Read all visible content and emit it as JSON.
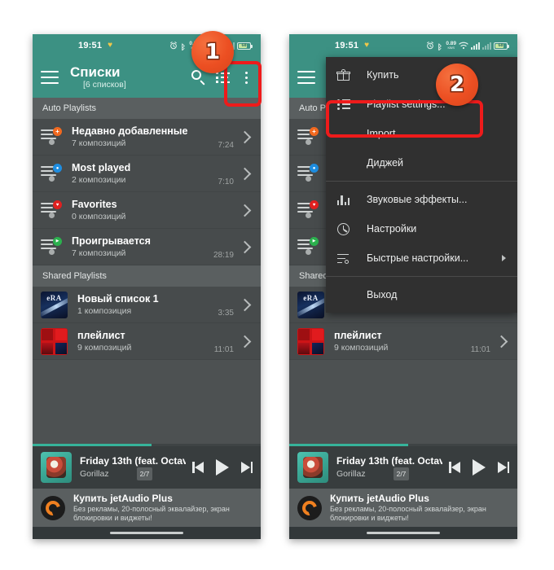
{
  "colors": {
    "teal": "#3c9183",
    "background": "#4d5152",
    "row": "#474b4c",
    "section": "#5a5f60",
    "menu": "#303030",
    "callout": "#ec4f22",
    "highlight": "#ee1b1b",
    "progress": "#36b39a"
  },
  "statusbar": {
    "time": "19:51",
    "heart_icon": "heart-icon",
    "alarm_icon": "alarm-icon",
    "bluetooth_icon": "bluetooth-icon",
    "data_speed_value": "0.15",
    "data_speed_unit": "KB/S",
    "data_speed_value_right": "0.89",
    "wifi_icon": "wifi-icon",
    "signal_icon": "signal-bars-icon",
    "battery_level": "68"
  },
  "toolbar": {
    "menu_icon": "hamburger-menu-icon",
    "title": "Списки",
    "subtitle": "[6 списков]",
    "search_icon": "search-icon",
    "view_icon": "list-view-icon",
    "overflow_icon": "overflow-menu-icon"
  },
  "sections": {
    "auto": "Auto Playlists",
    "shared": "Shared Playlists"
  },
  "auto_playlists": [
    {
      "name": "Недавно добавленные",
      "subtitle": "7 композиций",
      "time": "7:24",
      "badge_color": "#f2691f",
      "badge_glyph": "+",
      "icon": "playlist-icon"
    },
    {
      "name": "Most played",
      "subtitle": "2 композиции",
      "time": "7:10",
      "badge_color": "#1e8de0",
      "badge_glyph": "●",
      "icon": "playlist-icon"
    },
    {
      "name": "Favorites",
      "subtitle": "0 композиций",
      "time": "",
      "badge_color": "#e02020",
      "badge_glyph": "♥",
      "icon": "playlist-icon"
    },
    {
      "name": "Проигрывается",
      "subtitle": "7 композиций",
      "time": "28:19",
      "badge_color": "#2bb14e",
      "badge_glyph": "▶",
      "icon": "playlist-icon"
    }
  ],
  "shared_playlists": [
    {
      "name": "Новый список 1",
      "subtitle": "1 композиция",
      "time": "3:35",
      "art": "era-album-art",
      "art_caption": "eRA"
    },
    {
      "name": "плейлист",
      "subtitle": "9 композиций",
      "time": "11:01",
      "art": "red-collage-art",
      "art_caption": ""
    }
  ],
  "player": {
    "title": "Friday 13th (feat. Octav",
    "artist": "Gorillaz",
    "track_counter": "2/7",
    "progress_percent": 52,
    "album_art": "gorillaz-album-art",
    "prev_icon": "skip-previous-icon",
    "play_icon": "play-icon",
    "next_icon": "skip-next-icon"
  },
  "ad": {
    "logo_icon": "jetaudio-logo-icon",
    "title": "Купить jetAudio Plus",
    "subtitle": "Без рекламы, 20-полосный эквалайзер, экран блокировки и виджеты!"
  },
  "overflow_menu": {
    "items": [
      {
        "label": "Купить",
        "icon": "gift-icon",
        "has_icon": true,
        "has_arrow": false
      },
      {
        "label": "Playlist settings...",
        "icon": "numbered-list-icon",
        "has_icon": true,
        "has_arrow": false
      },
      {
        "label": "Import",
        "icon": "",
        "has_icon": false,
        "has_arrow": false
      },
      {
        "label": "Диджей",
        "icon": "",
        "has_icon": false,
        "has_arrow": false
      },
      {
        "separator": true
      },
      {
        "label": "Звуковые эффекты...",
        "icon": "equalizer-icon",
        "has_icon": true,
        "has_arrow": false
      },
      {
        "label": "Настройки",
        "icon": "gear-icon",
        "has_icon": true,
        "has_arrow": false
      },
      {
        "label": "Быстрые настройки...",
        "icon": "sliders-icon",
        "has_icon": true,
        "has_arrow": true
      },
      {
        "separator": true
      },
      {
        "label": "Выход",
        "icon": "",
        "has_icon": false,
        "has_arrow": false
      }
    ]
  },
  "callouts": [
    {
      "number": "1",
      "target": "overflow-menu-icon"
    },
    {
      "number": "2",
      "target": "playlist-settings-menu-item"
    }
  ]
}
